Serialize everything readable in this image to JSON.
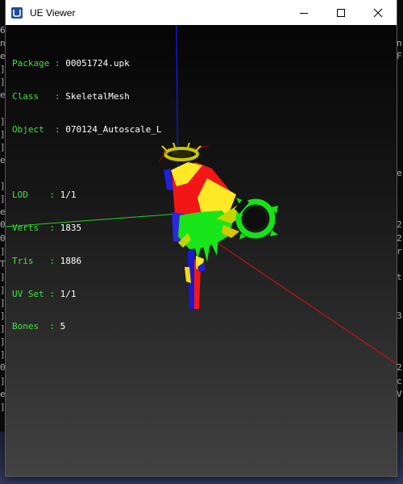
{
  "window": {
    "title": "UE Viewer"
  },
  "info": {
    "package_label": "Package",
    "package_value": "00051724.upk",
    "class_label": "Class",
    "class_value": "SkeletalMesh",
    "object_label": "Object",
    "object_value": "070124_Autoscale_L",
    "lod_label": "LOD",
    "lod_value": "1/1",
    "verts_label": "Verts",
    "verts_value": "1835",
    "tris_label": "Tris",
    "tris_value": "1886",
    "uvset_label": "UV Set",
    "uvset_value": "1/1",
    "bones_label": "Bones",
    "bones_value": "5",
    "separator": " : "
  },
  "background": {
    "left_chars": "6\nn\ne\n]\n]\ne\n\n]\n]\n]\ne\n \n]\n]\ne\n0\n0\n]\nT\n]\n]\n]\n]\n]\n]\n]\n0\n]\ne\n]",
    "right_chars": "\nn\nF\n\n\n\n\n\n\n\n\ne\n\n\n\n2\n2\nr\n\nt\n\n\n3\n\n\n\n2\nc\nV\n"
  },
  "colors": {
    "label_green": "#3fe43f",
    "value_white": "#ffffff",
    "axis_x": "#d41313",
    "axis_y": "#1fd51f",
    "axis_z": "#1616e0"
  },
  "icons": {
    "app": "ue-viewer-app-icon",
    "minimize": "minimize-icon",
    "maximize": "maximize-icon",
    "close": "close-icon"
  }
}
